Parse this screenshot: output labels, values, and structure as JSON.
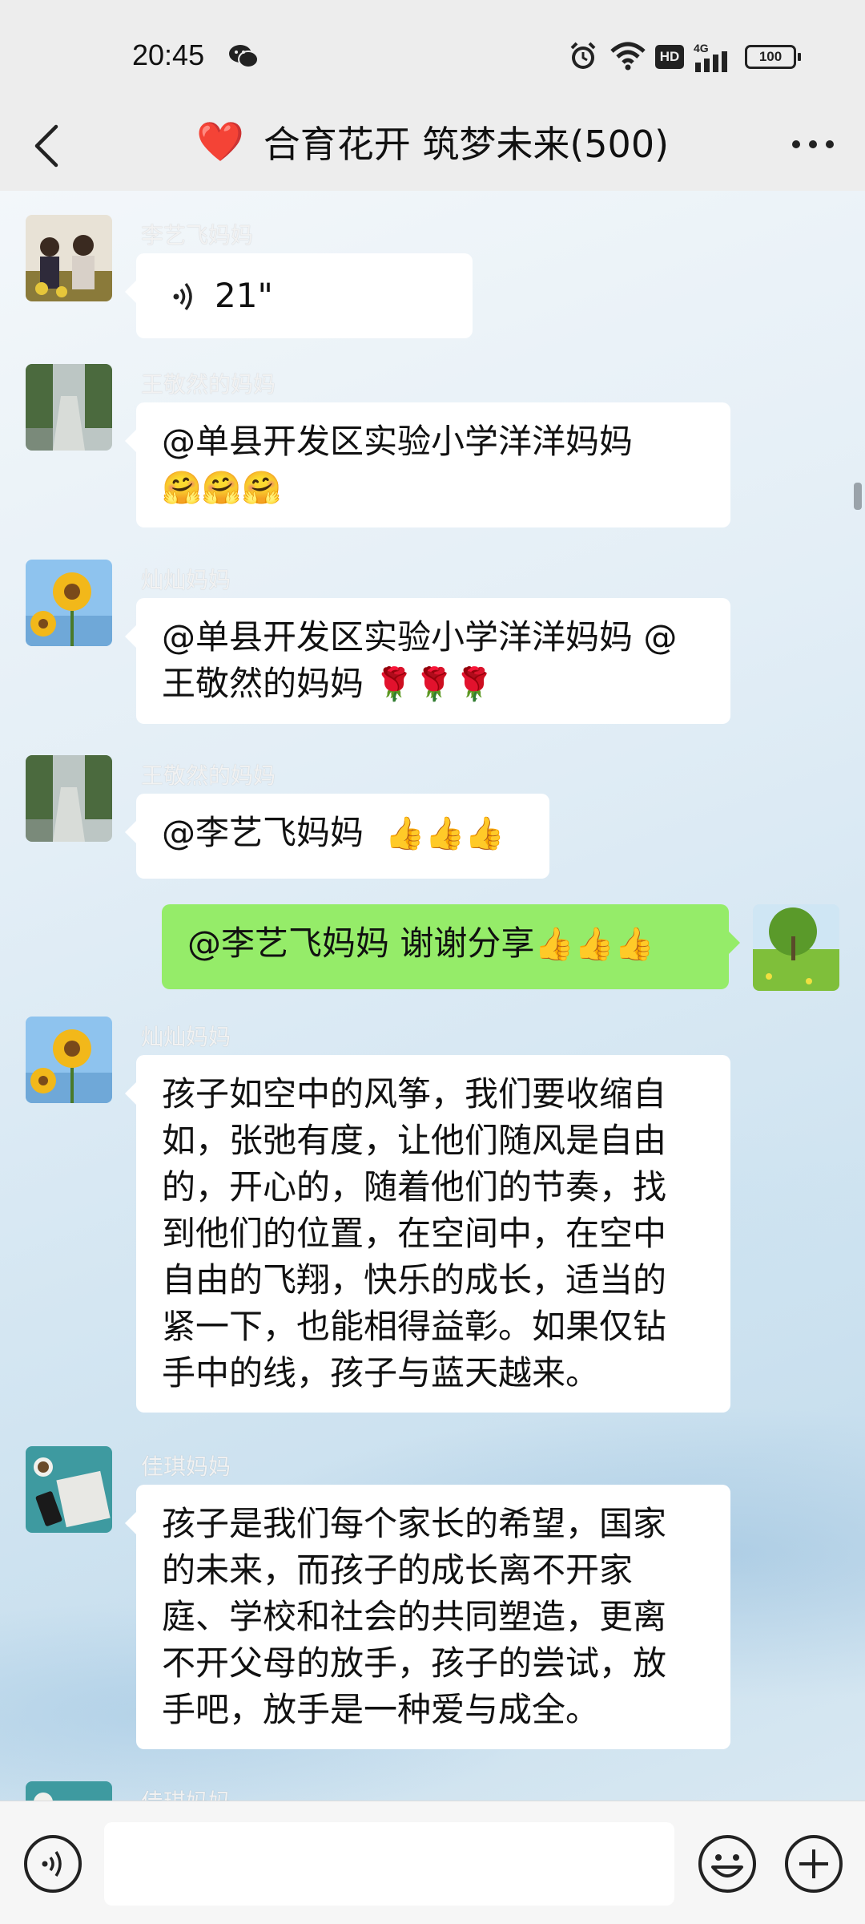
{
  "status": {
    "time": "20:45",
    "hd": "HD",
    "network": "4G",
    "battery": "100"
  },
  "header": {
    "title": "合育花开 筑梦未来(500)",
    "heart_emoji": "❤️"
  },
  "messages": [
    {
      "sender": "李艺飞妈妈",
      "type": "voice",
      "duration": "21\""
    },
    {
      "sender": "王敬然的妈妈",
      "text": "@单县开发区实验小学洋洋妈妈",
      "emoji": "🤗🤗🤗"
    },
    {
      "sender": "灿灿妈妈",
      "text": "@单县开发区实验小学洋洋妈妈 @",
      "text2": "王敬然的妈妈",
      "emoji": "🌹🌹🌹"
    },
    {
      "sender": "王敬然的妈妈",
      "text": "@李艺飞妈妈",
      "emoji": "👍👍👍"
    },
    {
      "sender": "",
      "mine": true,
      "text": "@李艺飞妈妈  谢谢分享",
      "emoji": "👍👍👍"
    },
    {
      "sender": "灿灿妈妈",
      "lines": [
        "孩子如空中的风筝，我们要收缩自",
        "如，张弛有度，让他们随风是自由",
        "的，开心的，随着他们的节奏，找",
        "到他们的位置，在空间中，在空中",
        "自由的飞翔，快乐的成长，适当的",
        "紧一下，也能相得益彰。如果仅钻",
        "手中的线，孩子与蓝天越来。"
      ]
    },
    {
      "sender": "佳琪妈妈",
      "lines": [
        "孩子是我们每个家长的希望，国家",
        "的未来，而孩子的成长离不开家",
        "庭、学校和社会的共同塑造，更离",
        "不开父母的放手，孩子的尝试，放",
        "手吧，放手是一种爱与成全。"
      ]
    },
    {
      "sender": "佳琪妈妈"
    }
  ],
  "colors": {
    "my_bubble": "#95ec69",
    "other_bubble": "#ffffff",
    "bar_bg": "#ededed",
    "heart": "#e0242a"
  }
}
